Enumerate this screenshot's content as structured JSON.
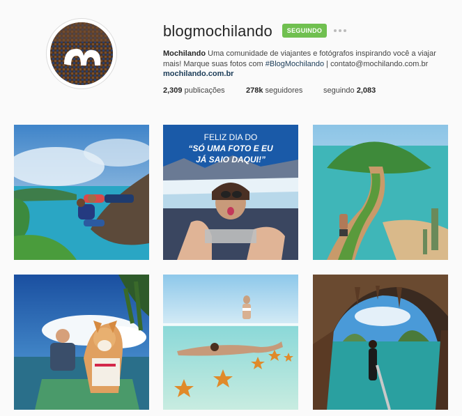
{
  "profile": {
    "username": "blogmochilando",
    "follow_label": "SEGUINDO",
    "name": "Mochilando",
    "bio_line1": " Uma comunidade de viajantes e fotógrafos inspirando você a viajar",
    "bio_line2": "mais! Marque suas fotos com ",
    "hashtag": "#BlogMochilando",
    "bio_line2_end": " | contato@mochilando.com.br",
    "link": "mochilando.com.br"
  },
  "stats": {
    "posts_count": "2,309",
    "posts_label": " publicações",
    "followers_count": "278k",
    "followers_label": " seguidores",
    "following_label": "seguindo ",
    "following_count": "2,083"
  },
  "posts": [
    {
      "scene": "couple on cliff edge above bay"
    },
    {
      "scene": "selfie at glacier",
      "line1": "FELIZ DIA DO",
      "line2": "“SÓ UMA FOTO E EU",
      "line3": "JÁ SAIO DAQUI!”"
    },
    {
      "scene": "hiker on green island isthmus"
    },
    {
      "scene": "man and dog on paddle board"
    },
    {
      "scene": "snorkeling with starfish"
    },
    {
      "scene": "sea cave with turquoise water"
    }
  ],
  "colors": {
    "follow_button": "#70c050",
    "link": "#1a3b57"
  }
}
